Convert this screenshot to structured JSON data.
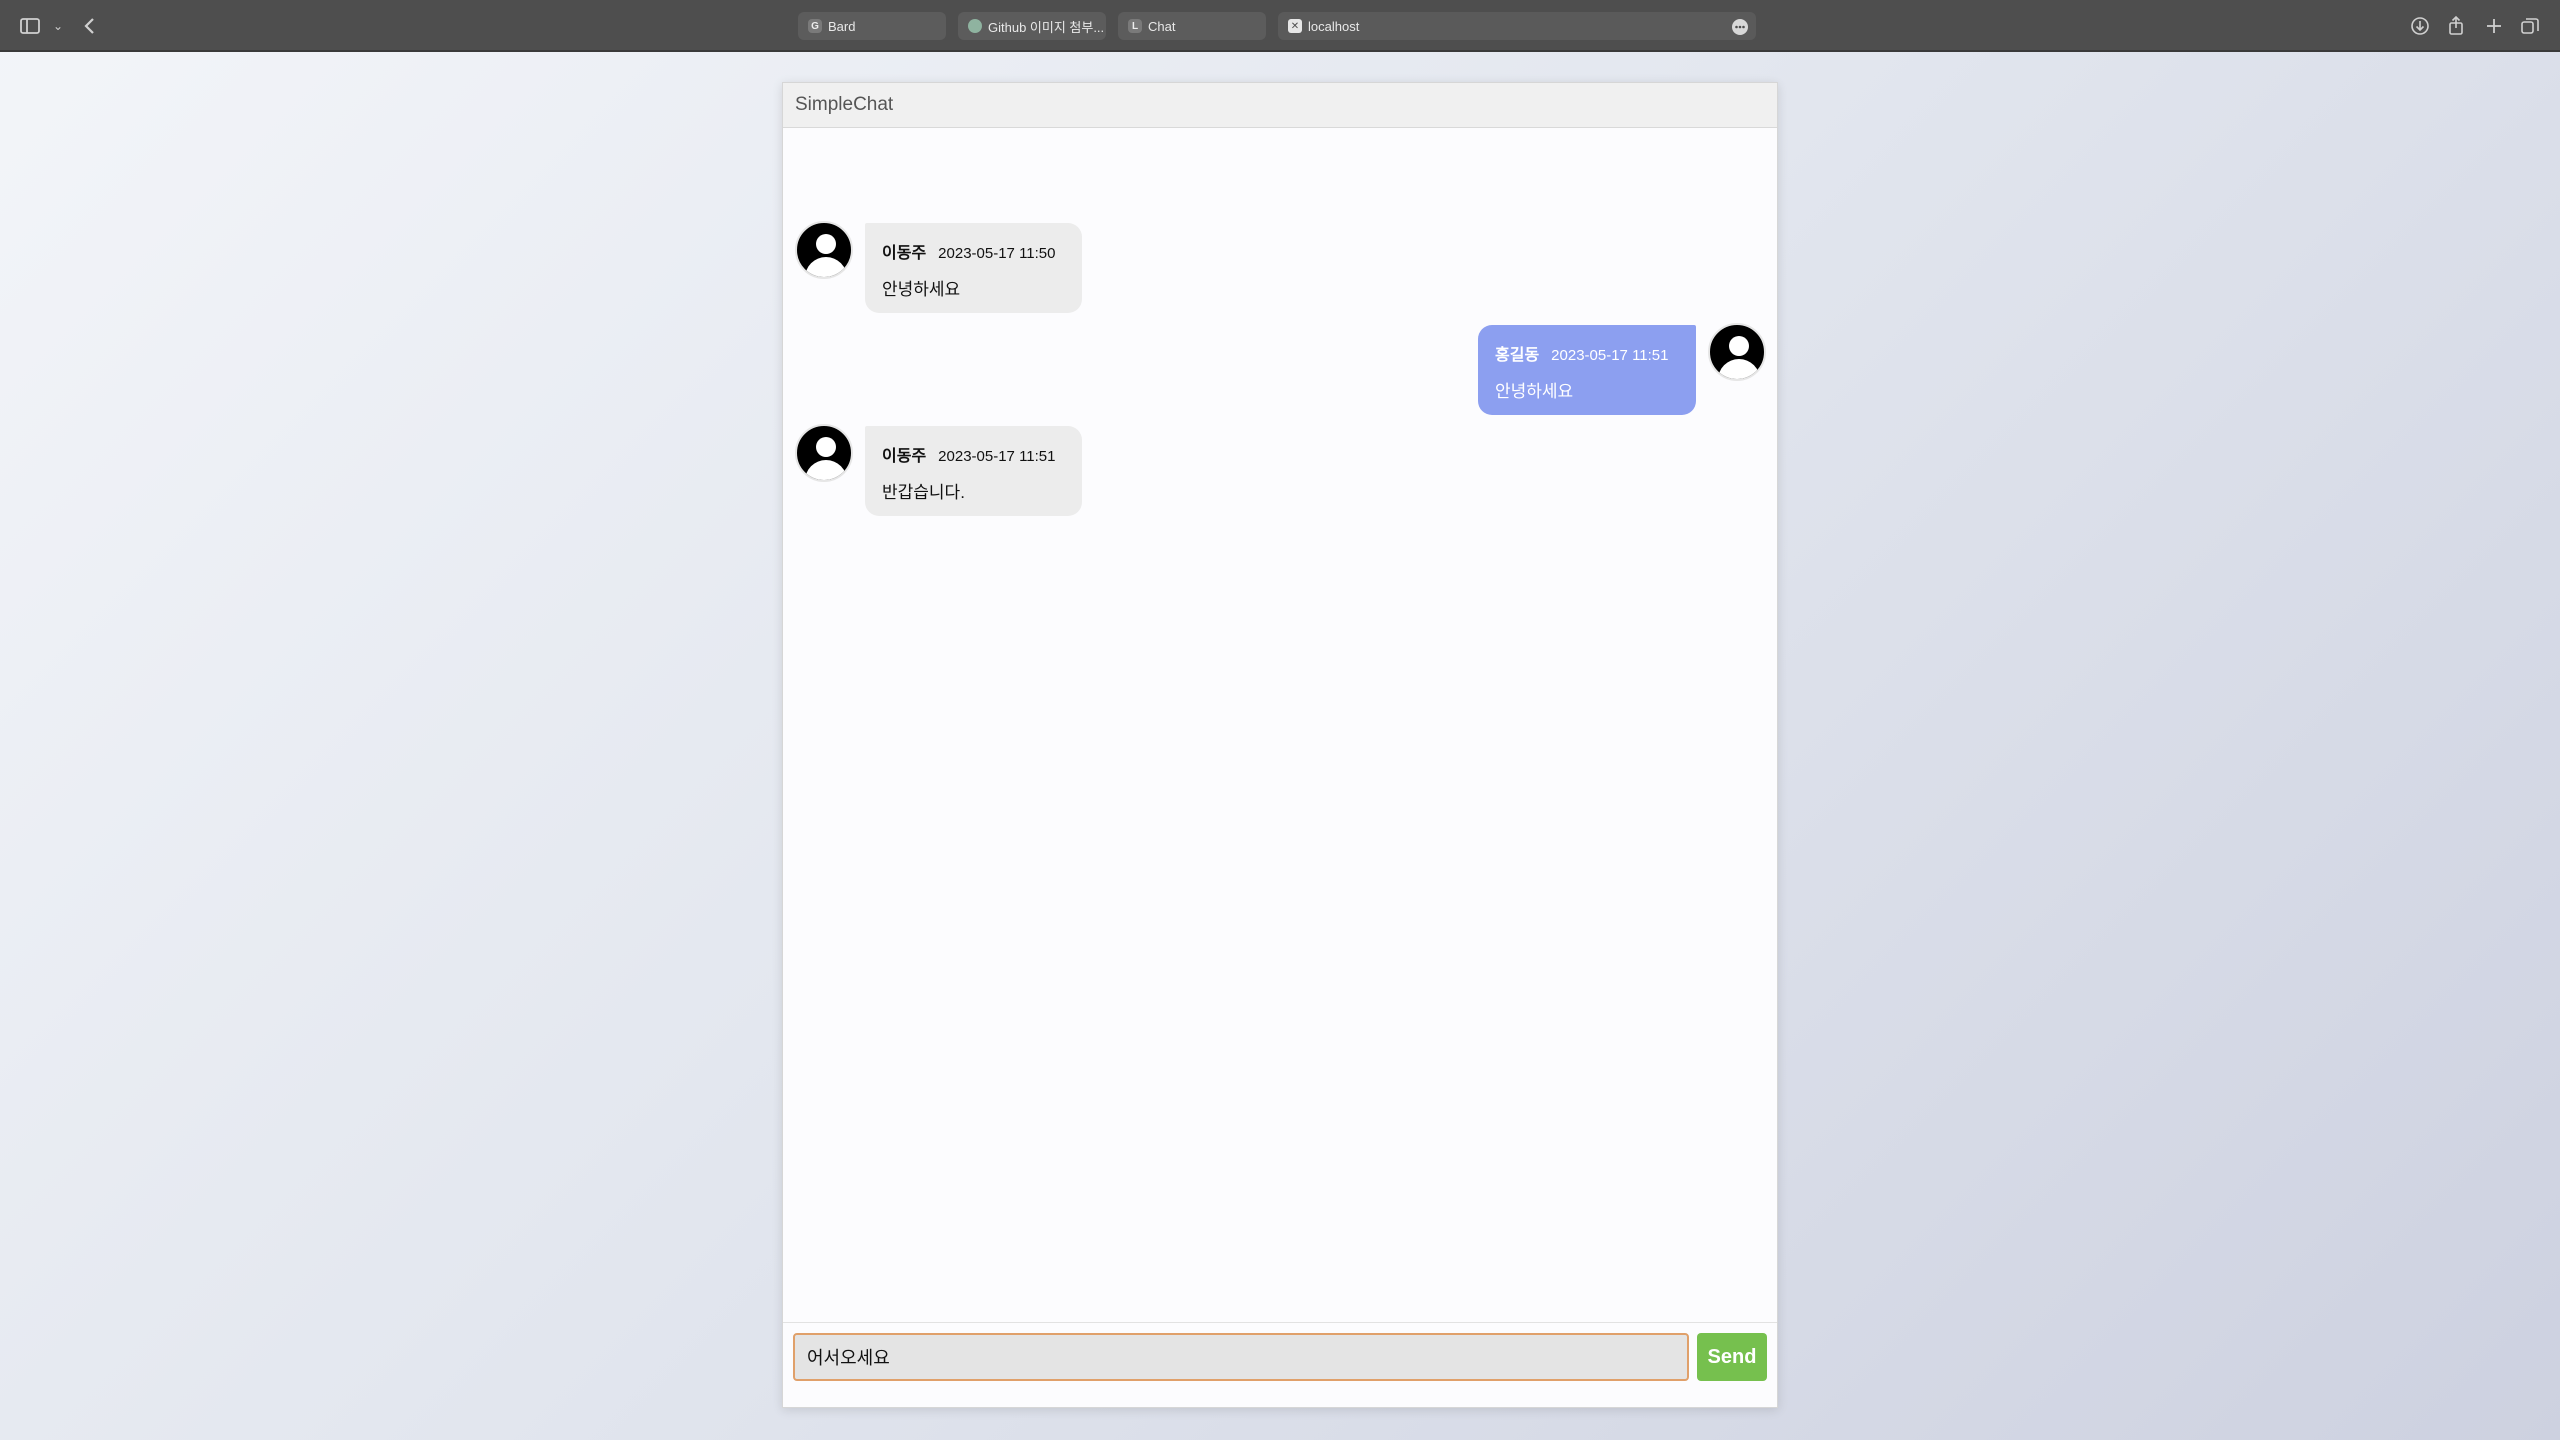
{
  "browser": {
    "tabs": [
      {
        "favicon": "G",
        "label": "Bard"
      },
      {
        "favicon": "",
        "label": "Github 이미지 첨부..."
      },
      {
        "favicon": "L",
        "label": "Chat"
      },
      {
        "favicon": "✕",
        "label": "localhost"
      }
    ],
    "more_glyph": "•••"
  },
  "app": {
    "title": "SimpleChat"
  },
  "messages": [
    {
      "side": "left",
      "sender": "이동주",
      "time": "2023-05-17 11:50",
      "text": "안녕하세요"
    },
    {
      "side": "right",
      "sender": "홍길동",
      "time": "2023-05-17 11:51",
      "text": "안녕하세요"
    },
    {
      "side": "left",
      "sender": "이동주",
      "time": "2023-05-17 11:51",
      "text": "반갑습니다."
    }
  ],
  "composer": {
    "value": "어서오세요",
    "send_label": "Send"
  },
  "colors": {
    "own_bubble": "#8c9ff0",
    "other_bubble": "#ececec",
    "send_button": "#76c04e",
    "input_focus_border": "#e0a06a"
  }
}
